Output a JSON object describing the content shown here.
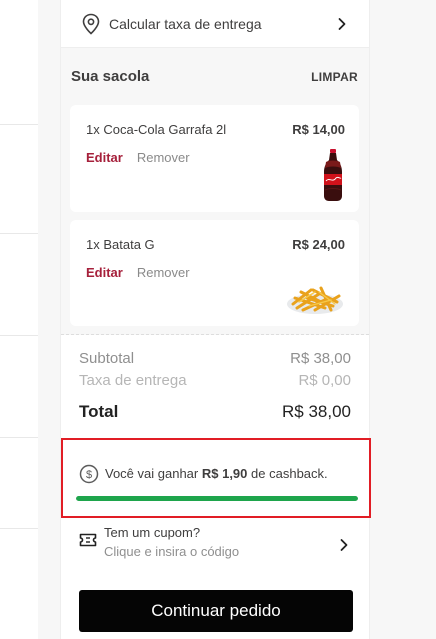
{
  "delivery": {
    "label": "Calcular taxa de entrega",
    "icon": "map-pin-icon"
  },
  "bag": {
    "title": "Sua sacola",
    "clear_label": "LIMPAR",
    "items": [
      {
        "qty_name": "1x Coca-Cola Garrafa 2l",
        "price": "R$ 14,00",
        "edit": "Editar",
        "remove": "Remover",
        "image": "coca-cola-bottle"
      },
      {
        "qty_name": "1x Batata G",
        "price": "R$ 24,00",
        "edit": "Editar",
        "remove": "Remover",
        "image": "french-fries"
      }
    ]
  },
  "totals": {
    "subtotal_label": "Subtotal",
    "subtotal_value": "R$ 38,00",
    "delivery_label": "Taxa de entrega",
    "delivery_value": "R$ 0,00",
    "total_label": "Total",
    "total_value": "R$ 38,00"
  },
  "cashback": {
    "prefix": "Você vai ganhar",
    "amount": "R$ 1,90",
    "suffix": "de cashback.",
    "progress": 1.0,
    "progress_color": "#1ea54c",
    "highlight_color": "#e11d25"
  },
  "coupon": {
    "title": "Tem um cupom?",
    "subtitle": "Clique e insira o código",
    "icon": "ticket-icon"
  },
  "cta": {
    "label": "Continuar pedido"
  },
  "colors": {
    "accent_edit": "#a6203b",
    "button_bg": "#050505"
  }
}
